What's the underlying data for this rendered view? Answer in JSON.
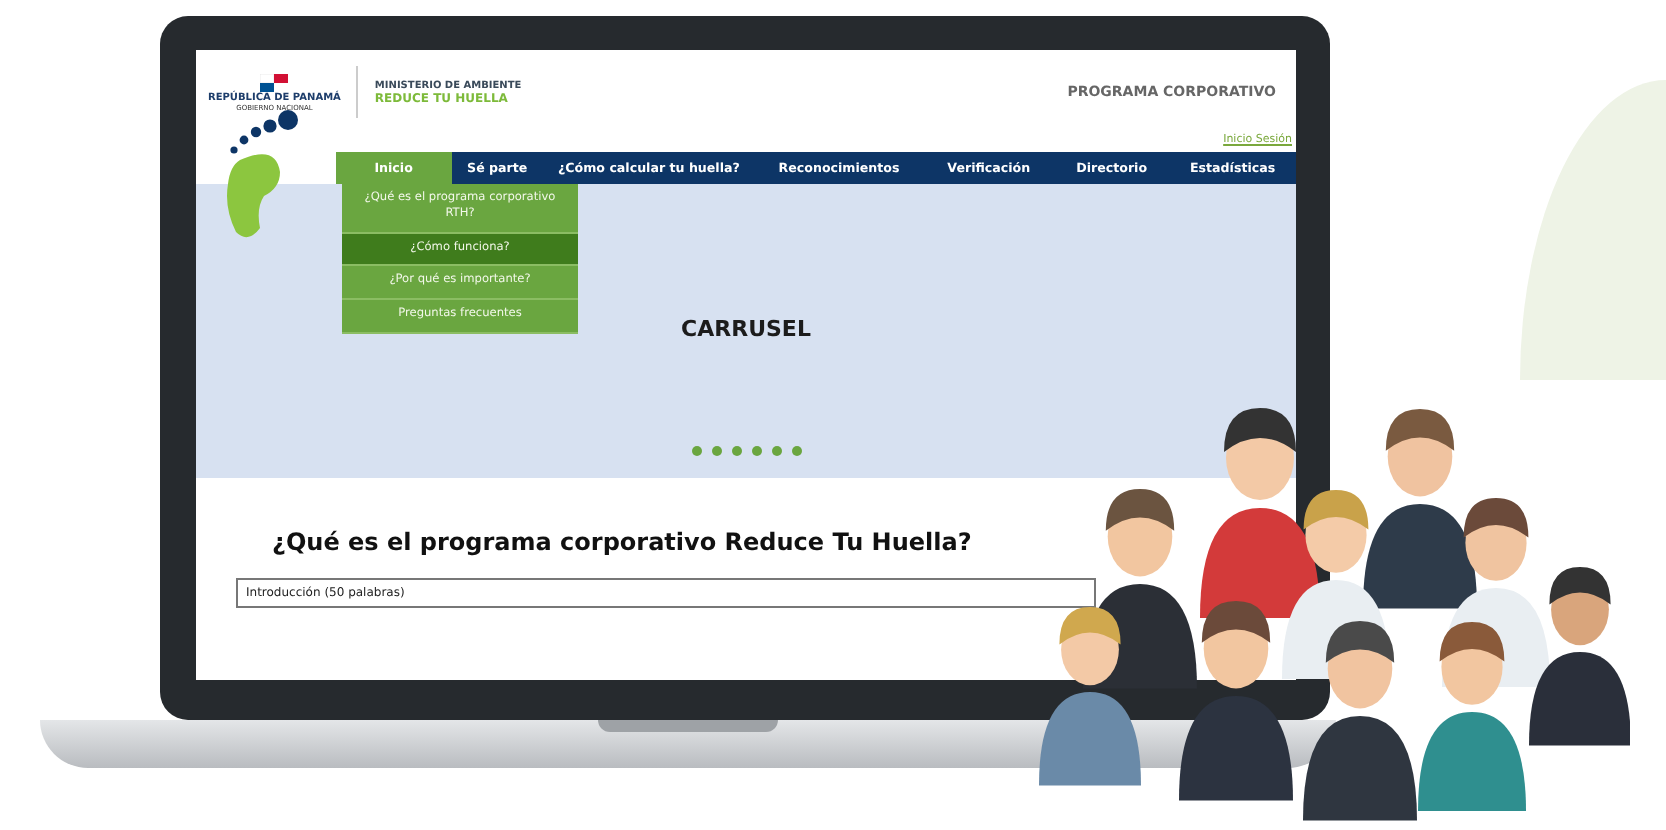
{
  "header": {
    "country": "REPÚBLICA DE PANAMÁ",
    "government": "GOBIERNO NACIONAL",
    "ministry": "MINISTERIO DE AMBIENTE",
    "program_name": "REDUCE TU HUELLA",
    "site_title": "PROGRAMA CORPORATIVO",
    "login_link": "Inicio Sesión"
  },
  "nav": [
    {
      "label": "Inicio",
      "selected": true
    },
    {
      "label": "Sé parte",
      "selected": false
    },
    {
      "label": "¿Cómo calcular tu huella?",
      "selected": false
    },
    {
      "label": "Reconocimientos",
      "selected": false
    },
    {
      "label": "Verificación",
      "selected": false
    },
    {
      "label": "Directorio",
      "selected": false
    },
    {
      "label": "Estadísticas",
      "selected": false
    }
  ],
  "dropdown": [
    {
      "label": "¿Qué es el programa corporativo RTH?",
      "selected": false
    },
    {
      "label": "¿Cómo funciona?",
      "selected": true
    },
    {
      "label": "¿Por qué es importante?",
      "selected": false
    },
    {
      "label": "Preguntas frecuentes",
      "selected": false
    }
  ],
  "carousel": {
    "title": "CARRUSEL"
  },
  "section": {
    "heading": "¿Qué es el programa corporativo Reduce Tu Huella?",
    "field_value": "Introducción (50 palabras)"
  }
}
